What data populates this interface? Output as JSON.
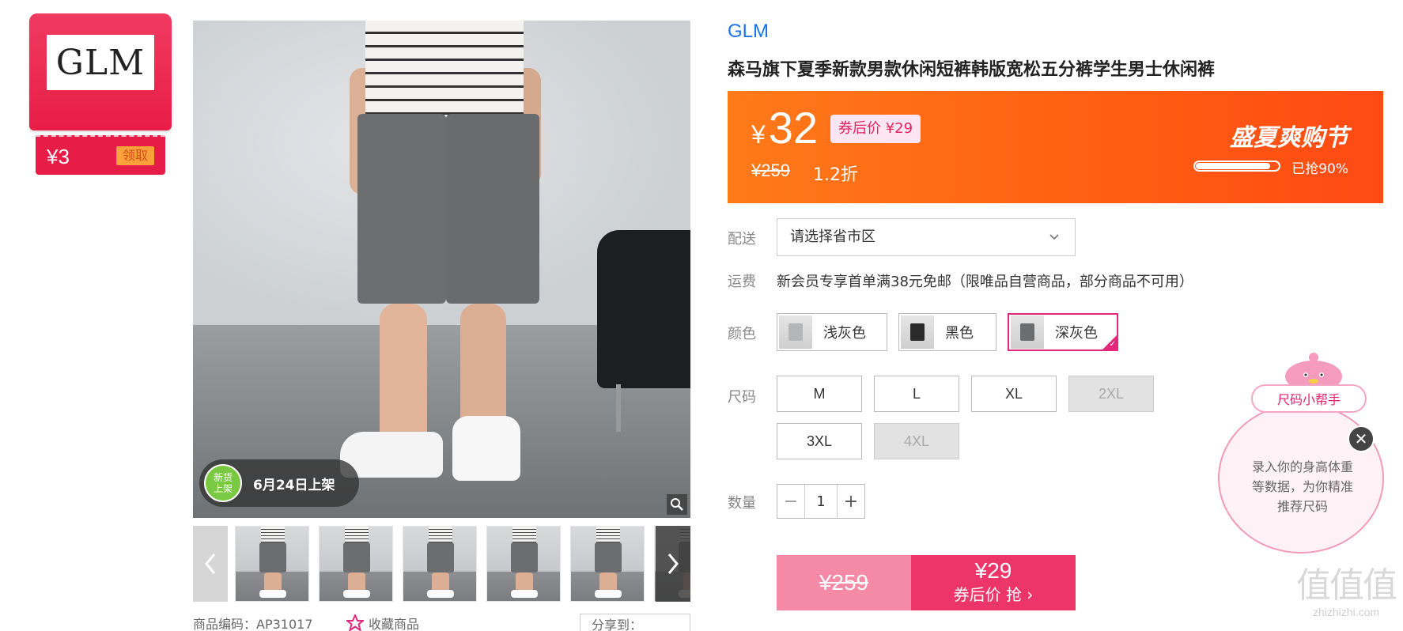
{
  "coupon": {
    "logo": "GLM",
    "amount": "¥3",
    "claim_label": "领取"
  },
  "gallery": {
    "new_badge": {
      "circle_text": "新货上架",
      "date_text": "6月24日上架"
    },
    "thumb_count": 6
  },
  "meta": {
    "code": "商品编码：AP31017",
    "favorite_label": "收藏商品",
    "share_label": "分享到："
  },
  "product": {
    "brand": "GLM",
    "title": "森马旗下夏季新款男款休闲短裤韩版宽松五分裤学生男士休闲裤"
  },
  "price": {
    "symbol": "¥",
    "current": "32",
    "coupon_price": "券后价 ¥29",
    "original": "¥259",
    "discount": "1.2折",
    "promo_title": "盛夏爽购节",
    "sold_fraction": 0.9,
    "sold_label": "已抢90%"
  },
  "shipping": {
    "label": "配送",
    "placeholder": "请选择省市区",
    "fee_label": "运费",
    "fee_text": "新会员专享首单满38元免邮（限唯品自营商品，部分商品不可用）"
  },
  "colors": {
    "label": "颜色",
    "options": [
      {
        "label": "浅灰色",
        "swatch": "#b5b6b8",
        "selected": false
      },
      {
        "label": "黑色",
        "swatch": "#2a2a2b",
        "selected": false
      },
      {
        "label": "深灰色",
        "swatch": "#6c6d6f",
        "selected": true
      }
    ]
  },
  "sizes": {
    "label": "尺码",
    "options": [
      {
        "label": "M",
        "available": true
      },
      {
        "label": "L",
        "available": true
      },
      {
        "label": "XL",
        "available": true
      },
      {
        "label": "2XL",
        "available": false
      },
      {
        "label": "3XL",
        "available": true
      },
      {
        "label": "4XL",
        "available": false
      }
    ]
  },
  "quantity": {
    "label": "数量",
    "value": "1",
    "minus": "−",
    "plus": "+"
  },
  "buy": {
    "original": "¥259",
    "price": "¥29",
    "action": "券后价 抢 ›"
  },
  "size_helper": {
    "title": "尺码小帮手",
    "text": "录入你的身高体重等数据，为你精准推荐尺码",
    "close": "✕"
  },
  "watermark": {
    "logo": "值值值",
    "url": "zhizhizhi.com"
  },
  "colors_theme": {
    "accent": "#e3287c",
    "price_band": "#ff5d12",
    "brand_link": "#1a73e8"
  }
}
